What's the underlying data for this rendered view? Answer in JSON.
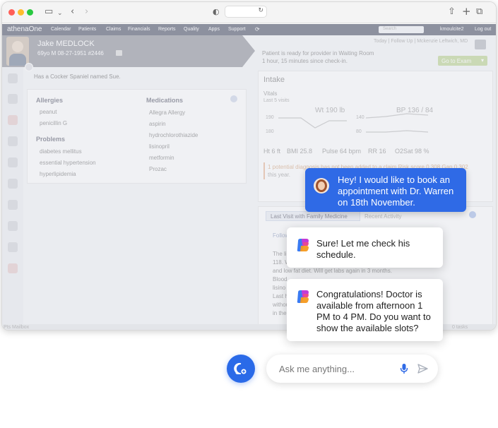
{
  "app": {
    "brand": "athenaOne",
    "nav": [
      "Calendar",
      "Patients",
      "Claims",
      "Financials",
      "Reports",
      "Quality",
      "Apps",
      "Support"
    ],
    "user": "kmoulcite2",
    "logout": "Log out",
    "search_placeholder": "Search"
  },
  "patient": {
    "name": "Jake MEDLOCK",
    "info": "69yo M  08-27-1951  #2446",
    "status_line1": "Patient is ready for provider in Waiting Room",
    "status_line2": "1 hour, 15 minutes since check-in.",
    "links": "Today | Follow Up | Mckenzie Leftwich, MD",
    "go_to_exam": "Go to Exam",
    "note": "Has a Cocker Spaniel named Sue."
  },
  "summary": {
    "allergies_title": "Allergies",
    "allergies": [
      "peanut",
      "penicillin G"
    ],
    "problems_title": "Problems",
    "problems": [
      "diabetes mellitus",
      "essential hypertension",
      "hyperlipidemia"
    ],
    "medications_title": "Medications",
    "medications": [
      "Allegra Allergy",
      "aspirin",
      "hydrochlorothiazide",
      "lisinopril",
      "metformin",
      "Prozac"
    ]
  },
  "intake": {
    "title": "Intake",
    "vitals_title": "Vitals",
    "vitals_sub": "Last 5 visits",
    "wt": "Wt 190 lb",
    "bp": "BP 136 / 84",
    "axis_left": [
      "190",
      "180"
    ],
    "axis_right": [
      "140",
      "80"
    ],
    "stats": [
      "Ht 6 ft",
      "BMI 25.8",
      "Pulse 64 bpm",
      "RR 16",
      "O2Sat 98 %"
    ],
    "alert": "1 potential diagnosis has not been added to a claim  Risk score 0.308  Gap 0.302",
    "alert_line2": "this year.",
    "tab_active": "Last Visit with Family Medicine",
    "tab_other": "Recent Activity",
    "followup_label": "Follow",
    "body_lines": [
      "The lip",
      "118. W",
      "and low fat diet. Will get labs again in 3 months.",
      "Blood",
      "lisino",
      "Last h",
      "withou",
      "in the"
    ]
  },
  "footer": {
    "mailbox": "Pts Mailbox",
    "tasks": "0 tasks"
  },
  "chat": {
    "user_message": "Hey! I would like to book an appointment with Dr. Warren on 18th November.",
    "bot_message_1": "Sure! Let me check his schedule.",
    "bot_message_2": "Congratulations! Doctor is available from afternoon 1 PM to 4 PM. Do you want to show the available slots?",
    "input_placeholder": "Ask me anything..."
  },
  "colors": {
    "accent": "#2f6ae6",
    "nav_bg": "#4a4f63",
    "patient_bar": "#8a8c96"
  }
}
